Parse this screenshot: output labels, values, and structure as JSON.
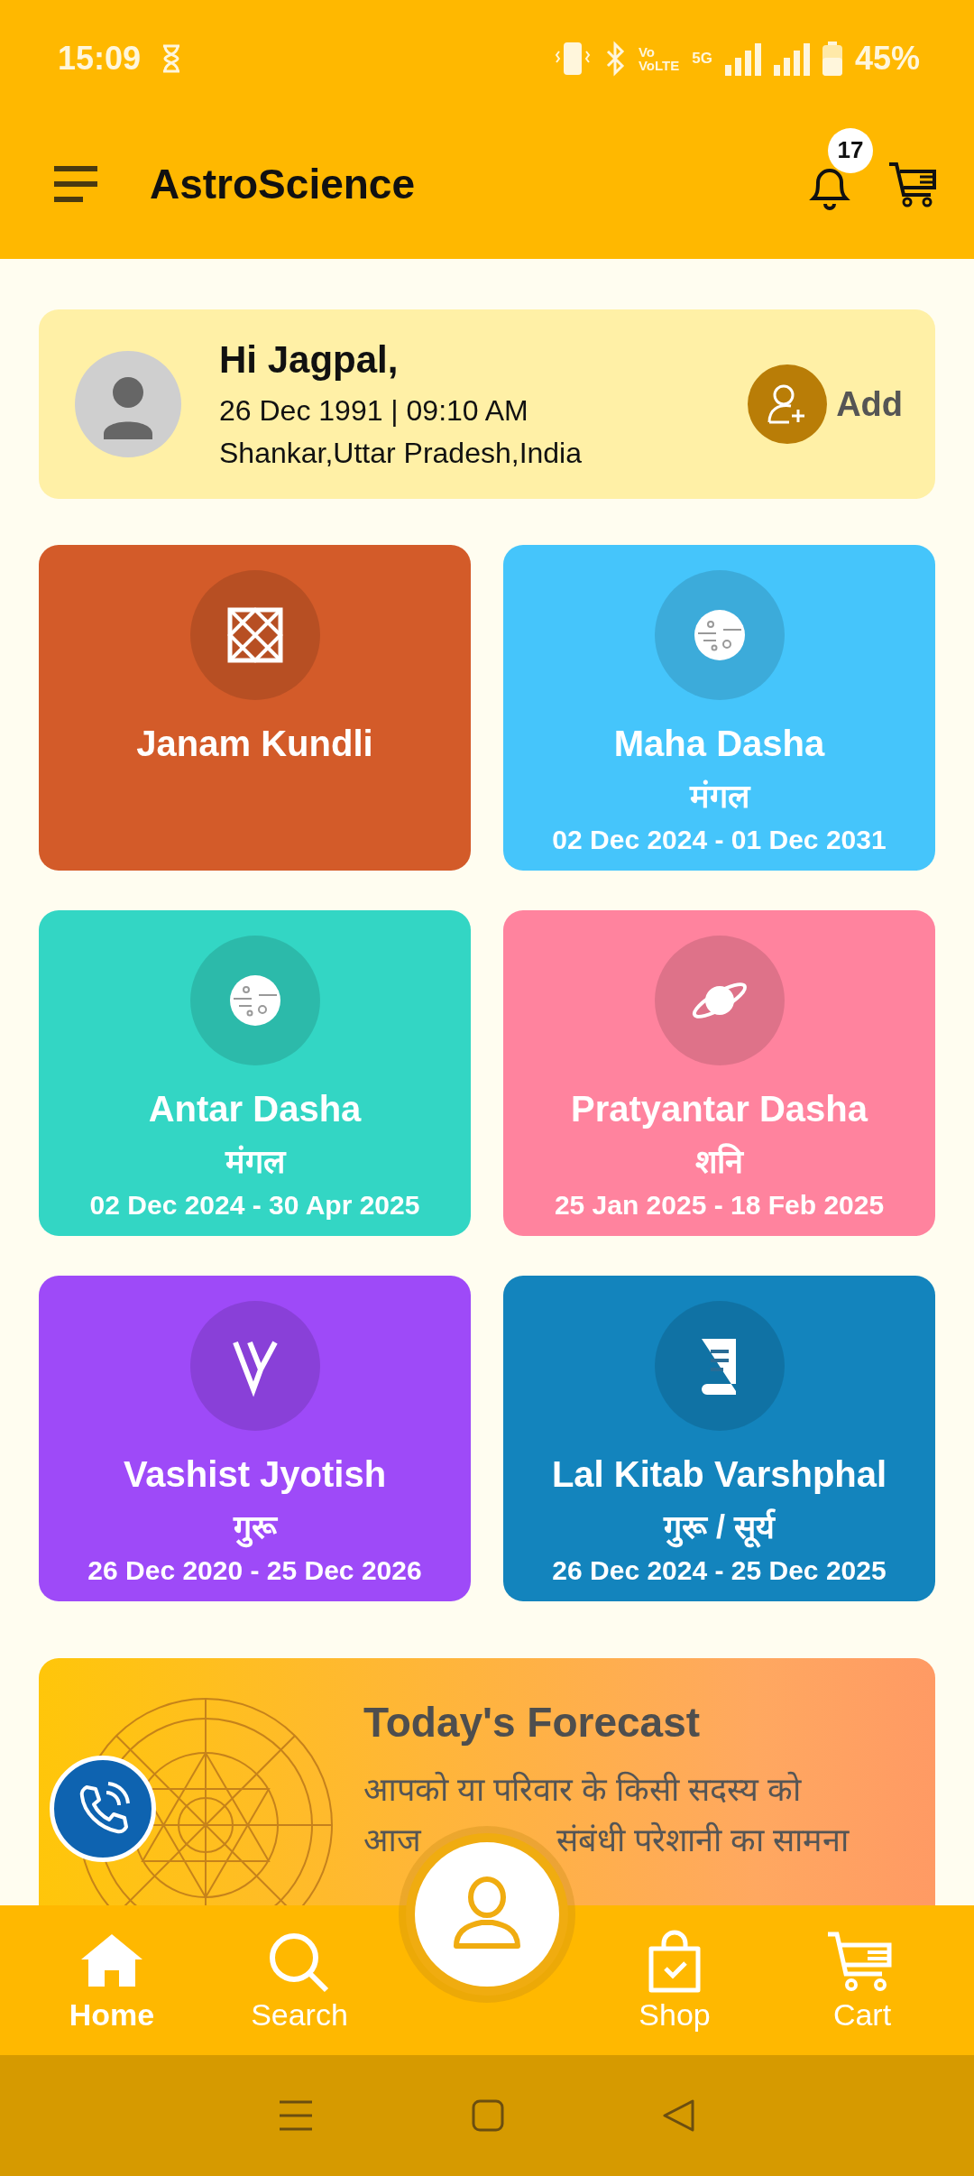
{
  "status_bar": {
    "time": "15:09",
    "sim_label": "Vo",
    "volte_label": "VoLTE",
    "network": "5G",
    "battery": "45%"
  },
  "header": {
    "title": "AstroScience",
    "notification_count": "17"
  },
  "profile": {
    "greeting": "Hi Jagpal,",
    "birth": "26 Dec 1991 | 09:10 AM",
    "place": "Shankar,Uttar Pradesh,India",
    "add_label": "Add"
  },
  "cards": [
    {
      "kind": "kundli",
      "title": "Janam Kundli",
      "color": "#d35b29"
    },
    {
      "kind": "moon",
      "title": "Maha Dasha",
      "subtitle": "मंगल",
      "period": "02 Dec 2024 - 01 Dec 2031",
      "color": "#45c5fb"
    },
    {
      "kind": "moon",
      "title": "Antar Dasha",
      "subtitle": "मंगल",
      "period": "02 Dec 2024 - 30 Apr 2025",
      "color": "#33d6c4"
    },
    {
      "kind": "planet",
      "title": "Pratyantar Dasha",
      "subtitle": "शनि",
      "period": "25 Jan 2025 - 18 Feb 2025",
      "color": "#ff839e"
    },
    {
      "kind": "vlogo",
      "title": "Vashist Jyotish",
      "subtitle": "गुरू",
      "period": "26 Dec 2020 - 25 Dec 2026",
      "color": "#9e4af8"
    },
    {
      "kind": "book",
      "title": "Lal Kitab Varshphal",
      "subtitle": "गुरू / सूर्य",
      "period": "26 Dec 2024 - 25 Dec 2025",
      "color": "#1384bd"
    }
  ],
  "forecast": {
    "title": "Today's Forecast",
    "line_1": "आपको या परिवार के किसी सदस्य को",
    "line_2_start": "आज",
    "line_2_end": "संबंधी परेशानी का सामना"
  },
  "bottom_nav": [
    {
      "kind": "home",
      "label": "Home",
      "selected": true
    },
    {
      "kind": "search",
      "label": "Search",
      "selected": false
    },
    {
      "kind": "shop",
      "label": "Shop",
      "selected": false
    },
    {
      "kind": "cart",
      "label": "Cart",
      "selected": false
    }
  ]
}
